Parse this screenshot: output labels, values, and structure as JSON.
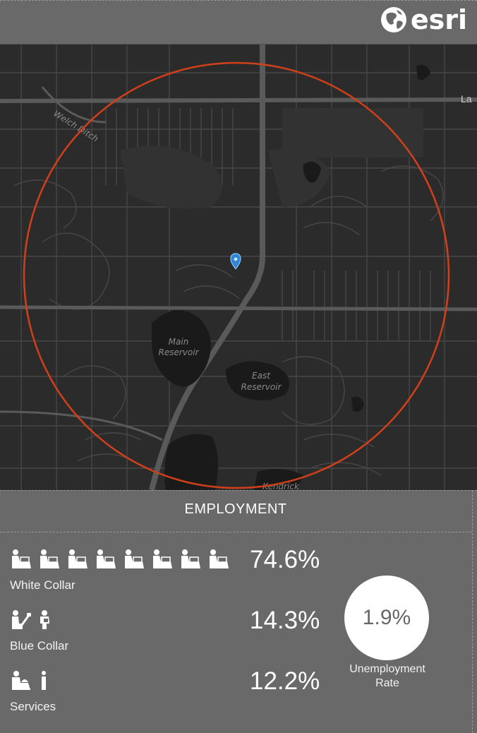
{
  "header": {
    "logo_text": "esri",
    "logo_icon": "globe-icon"
  },
  "map": {
    "labels": {
      "main_reservoir_line1": "Main",
      "main_reservoir_line2": "Reservoir",
      "east_reservoir_line1": "East",
      "east_reservoir_line2": "Reservoir",
      "welch_ditch": "Welch Ditch",
      "kendrick": "Kendrick",
      "edge_label": "La"
    },
    "ring_color": "#d2401a",
    "pin_color": "#2f86d6",
    "pin_icon": "location-pin-icon"
  },
  "employment": {
    "title": "EMPLOYMENT",
    "rows": [
      {
        "label": "White Collar",
        "value": "74.6%",
        "icon": "white-collar-worker-icon",
        "icon_count": 8
      },
      {
        "label": "Blue Collar",
        "value": "14.3%",
        "icon": "blue-collar-worker-icon",
        "icon_count": 2
      },
      {
        "label": "Services",
        "value": "12.2%",
        "icon": "services-worker-icon",
        "icon_count": 2
      }
    ],
    "unemployment": {
      "value": "1.9%",
      "label_line1": "Unemployment",
      "label_line2": "Rate"
    }
  }
}
